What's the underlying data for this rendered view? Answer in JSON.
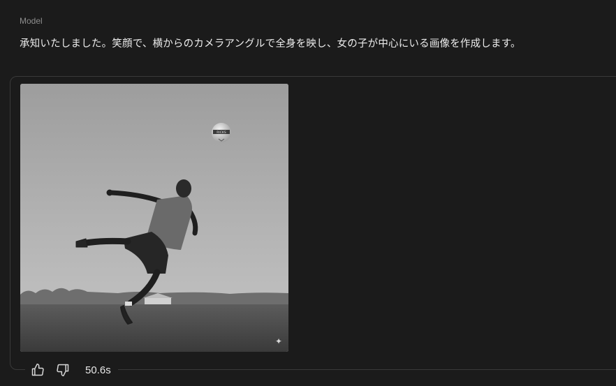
{
  "message": {
    "role": "Model",
    "text": "承知いたしました。笑顔で、横からのカメラアングルで全身を映し、女の子が中心にいる画像を作成します。"
  },
  "image": {
    "ball_text": "RICKS"
  },
  "feedback": {
    "duration": "50.6s",
    "like_icon": "thumbs-up-icon",
    "dislike_icon": "thumbs-down-icon"
  }
}
